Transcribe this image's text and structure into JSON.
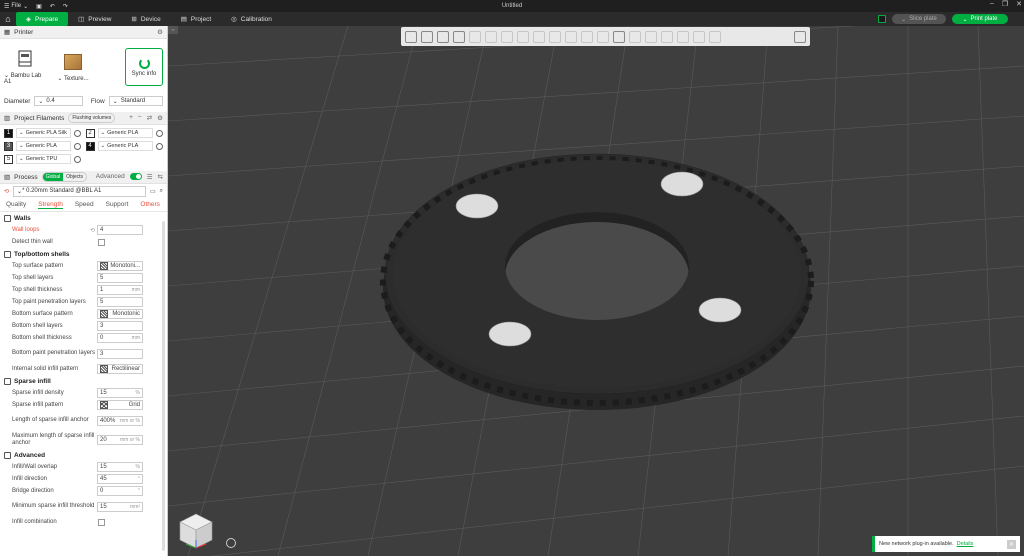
{
  "titlebar": {
    "file_menu": "File",
    "title": "Untitled"
  },
  "nav": {
    "tabs": [
      {
        "label": "Prepare"
      },
      {
        "label": "Preview"
      },
      {
        "label": "Device"
      },
      {
        "label": "Project"
      },
      {
        "label": "Calibration"
      }
    ],
    "slice_label": "Slice plate",
    "print_label": "Print plate"
  },
  "printer": {
    "title": "Printer",
    "name": "Bambu Lab A1",
    "plate": "Texture...",
    "sync_label": "Sync info",
    "diameter_label": "Diameter",
    "diameter_value": "0.4",
    "flow_label": "Flow",
    "flow_value": "Standard"
  },
  "filaments": {
    "title": "Project Filaments",
    "flushing_label": "Flushing volumes",
    "items": [
      {
        "num": "1",
        "name": "Generic PLA Silk"
      },
      {
        "num": "2",
        "name": "Generic PLA"
      },
      {
        "num": "3",
        "name": "Generic PLA"
      },
      {
        "num": "4",
        "name": "Generic PLA"
      },
      {
        "num": "5",
        "name": "Generic TPU"
      }
    ]
  },
  "process": {
    "title": "Process",
    "global_label": "Global",
    "objects_label": "Objects",
    "advanced_label": "Advanced",
    "preset": "* 0.20mm Standard @BBL A1",
    "tabs": [
      "Quality",
      "Strength",
      "Speed",
      "Support",
      "Others"
    ]
  },
  "walls": {
    "title": "Walls",
    "wall_loops_label": "Wall loops",
    "wall_loops": "4",
    "detect_thin_label": "Detect thin wall"
  },
  "topbottom": {
    "title": "Top/bottom shells",
    "rows": [
      {
        "label": "Top surface pattern",
        "value": "Monotoni...",
        "kind": "pattern"
      },
      {
        "label": "Top shell layers",
        "value": "5",
        "kind": "spin"
      },
      {
        "label": "Top shell thickness",
        "value": "1",
        "unit": "mm",
        "kind": "input"
      },
      {
        "label": "Top paint penetration layers",
        "value": "5",
        "kind": "spin"
      },
      {
        "label": "Bottom surface pattern",
        "value": "Monotonic",
        "kind": "pattern"
      },
      {
        "label": "Bottom shell layers",
        "value": "3",
        "kind": "spin"
      },
      {
        "label": "Bottom shell thickness",
        "value": "0",
        "unit": "mm",
        "kind": "input"
      },
      {
        "label": "Bottom paint penetration layers",
        "value": "3",
        "kind": "spin"
      },
      {
        "label": "Internal solid infill pattern",
        "value": "Rectilinear",
        "kind": "pattern"
      }
    ]
  },
  "sparse": {
    "title": "Sparse infill",
    "density_label": "Sparse infill density",
    "density": "15",
    "density_unit": "%",
    "pattern_label": "Sparse infill pattern",
    "pattern": "Grid",
    "anchor_label": "Length of sparse infill anchor",
    "anchor": "400%",
    "anchor_unit": "mm or %",
    "max_anchor_label": "Maximum length of sparse infill anchor",
    "max_anchor": "20",
    "max_anchor_unit": "mm or %"
  },
  "advanced": {
    "title": "Advanced",
    "overlap_label": "Infill/Wall overlap",
    "overlap": "15",
    "overlap_unit": "%",
    "direction_label": "Infill direction",
    "direction": "45",
    "direction_unit": "°",
    "bridge_label": "Bridge direction",
    "bridge": "0",
    "bridge_unit": "°",
    "min_sparse_label": "Minimum sparse infill threshold",
    "min_sparse": "15",
    "min_sparse_unit": "mm²",
    "combination_label": "Infill combination"
  },
  "notification": {
    "text": "New network plug-in available.",
    "link": "Details"
  },
  "colors": {
    "accent": "#00ae42",
    "warning": "#e8503a",
    "bed": "#3e3e3e",
    "part": "#2a2a2a"
  }
}
